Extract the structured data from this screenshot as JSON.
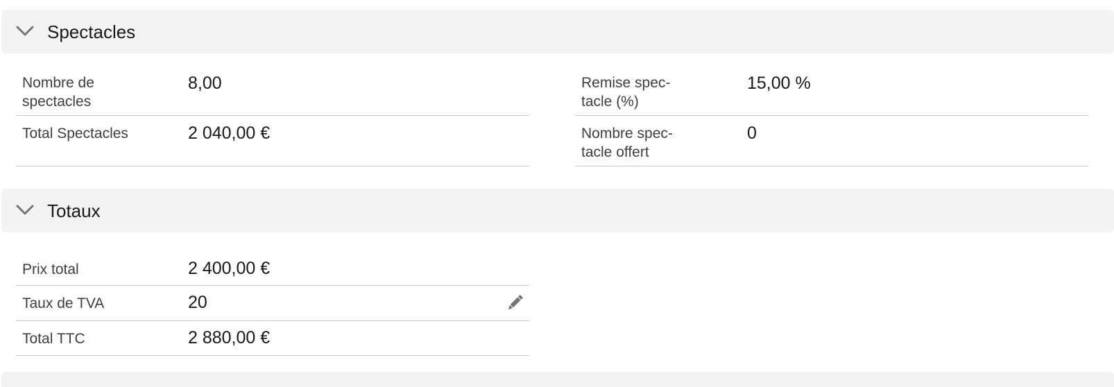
{
  "sections": {
    "spectacles": {
      "title": "Spectacles",
      "fields": {
        "nombre_spectacles": {
          "label": "Nombre de spectacles",
          "value": "8,00"
        },
        "remise_spectacle": {
          "label": "Remise spec-tacle (%)",
          "value": "15,00 %"
        },
        "total_spectacles": {
          "label": "Total Spectacles",
          "value": "2 040,00 €"
        },
        "nombre_offert": {
          "label": "Nombre spec-tacle offert",
          "value": "0"
        }
      }
    },
    "totaux": {
      "title": "Totaux",
      "fields": {
        "prix_total": {
          "label": "Prix total",
          "value": "2 400,00 €"
        },
        "taux_tva": {
          "label": "Taux de TVA",
          "value": "20"
        },
        "total_ttc": {
          "label": "Total TTC",
          "value": "2 880,00 €"
        }
      }
    }
  },
  "icons": {
    "collapse": "chevron-down-icon",
    "edit": "pencil-icon"
  },
  "colors": {
    "header_bg": "#f3f3f3",
    "divider": "#c9c9c9",
    "label": "#3e3e3c",
    "value": "#181818",
    "icon": "#747474"
  }
}
